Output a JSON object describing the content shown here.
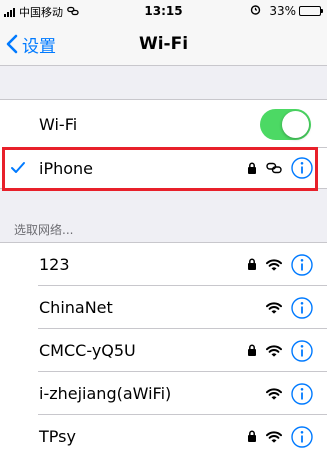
{
  "status_bar": {
    "carrier": "中国移动",
    "time": "13:15",
    "battery": "33%",
    "battery_level": 0.33
  },
  "nav": {
    "back_label": "设置",
    "title": "Wi-Fi"
  },
  "wifi_toggle": {
    "label": "Wi-Fi",
    "on": true
  },
  "connected_network": {
    "name": "iPhone",
    "secured": true,
    "icon": "hotspot-link-icon"
  },
  "section_header": "选取网络...",
  "networks": [
    {
      "name": "123",
      "secured": true
    },
    {
      "name": "ChinaNet",
      "secured": false
    },
    {
      "name": "CMCC-yQ5U",
      "secured": true
    },
    {
      "name": "i-zhejiang(aWiFi)",
      "secured": false
    },
    {
      "name": "TPsy",
      "secured": true
    }
  ],
  "colors": {
    "accent": "#007aff",
    "toggle_on": "#4cd964",
    "highlight": "#e8202a"
  }
}
